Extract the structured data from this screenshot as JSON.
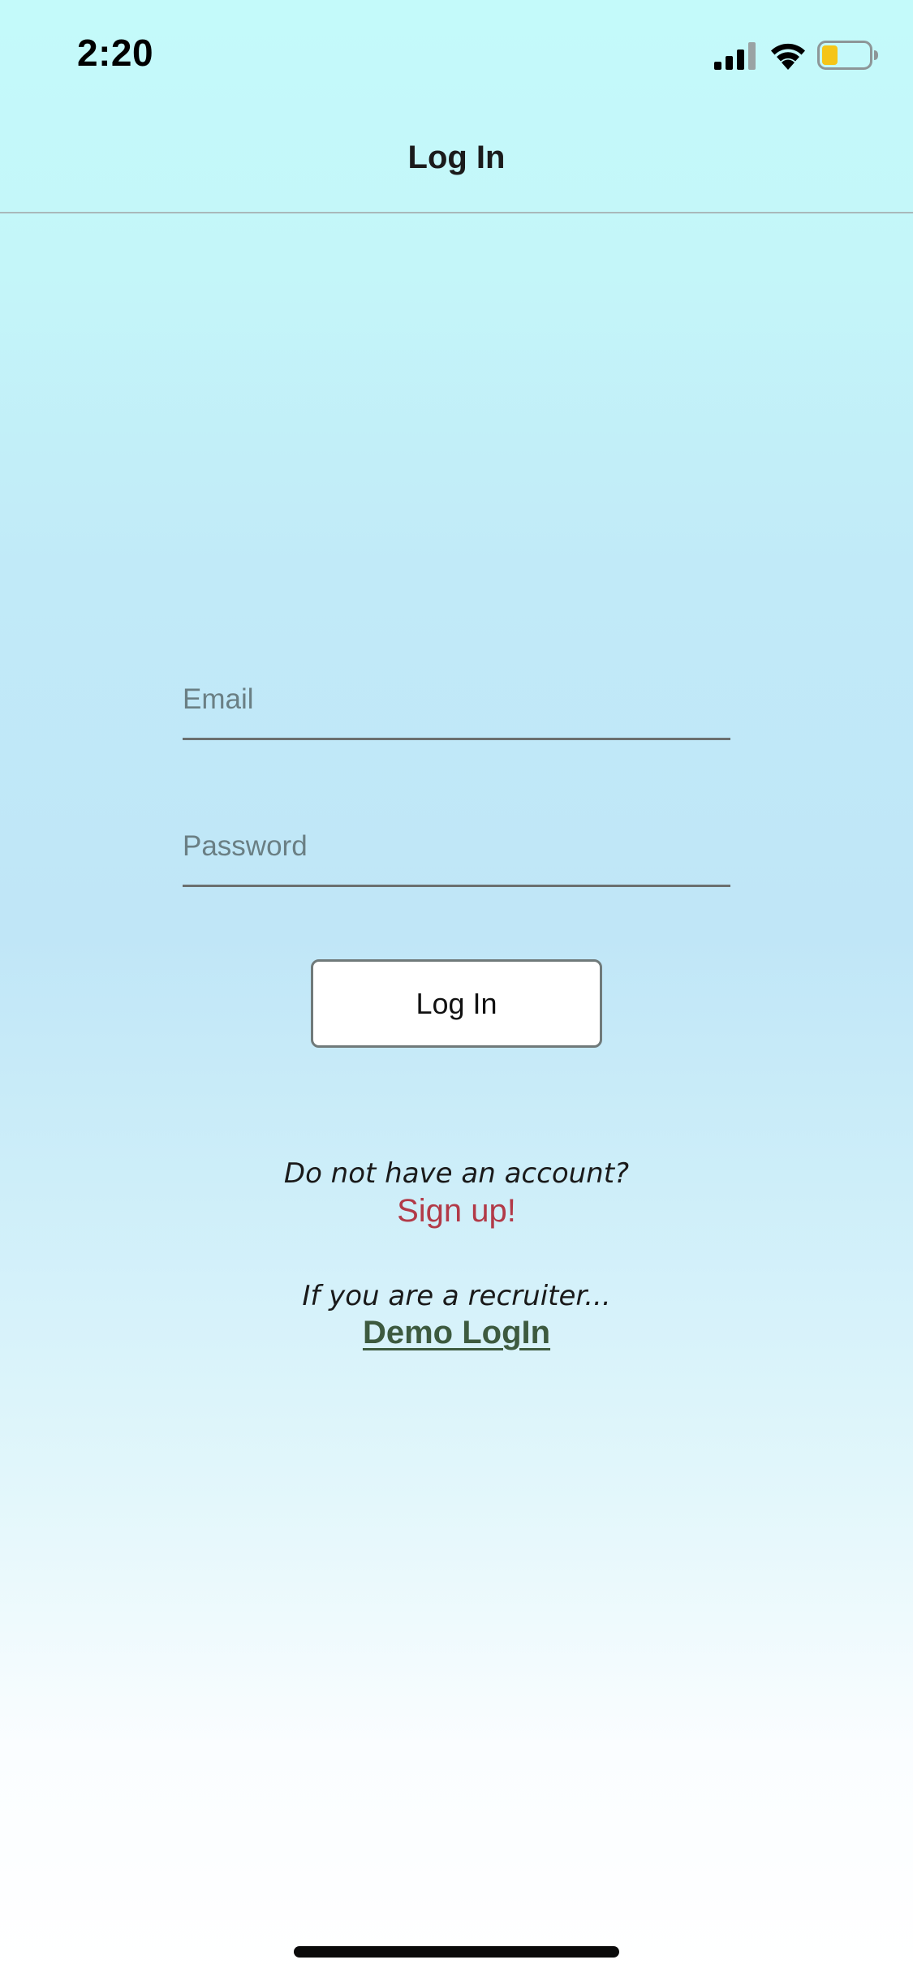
{
  "status_bar": {
    "time": "2:20",
    "signal_icon": "cellular-signal-icon",
    "wifi_icon": "wifi-icon",
    "battery_icon": "battery-icon",
    "battery_color": "#f5c518"
  },
  "nav": {
    "title": "Log In"
  },
  "form": {
    "email": {
      "placeholder": "Email",
      "value": ""
    },
    "password": {
      "placeholder": "Password",
      "value": ""
    },
    "login_label": "Log In"
  },
  "signup": {
    "prompt": "Do not have an account?",
    "link_label": "Sign up!",
    "link_color": "#b23a48"
  },
  "demo": {
    "prompt": "If you are a recruiter...",
    "link_label": "Demo LogIn",
    "link_color": "#3d5a3f"
  },
  "colors": {
    "background_top": "#c4fafa",
    "background_bottom": "#ffffff"
  }
}
